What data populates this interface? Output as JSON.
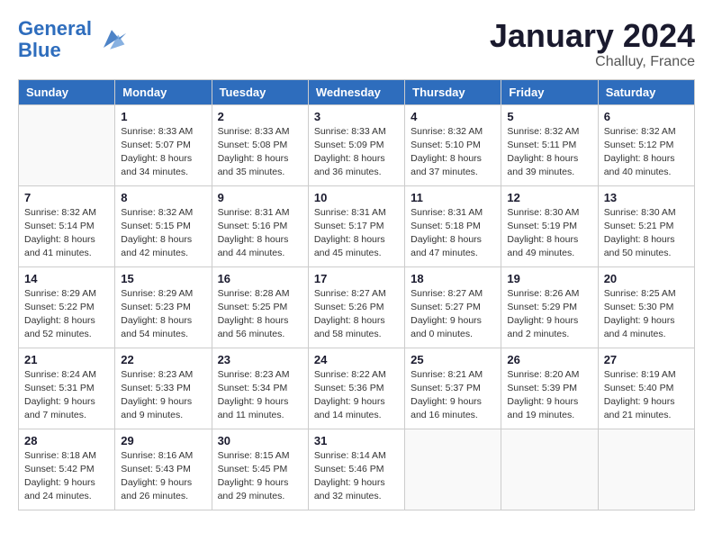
{
  "header": {
    "logo_line1": "General",
    "logo_line2": "Blue",
    "month_title": "January 2024",
    "location": "Challuy, France"
  },
  "days_of_week": [
    "Sunday",
    "Monday",
    "Tuesday",
    "Wednesday",
    "Thursday",
    "Friday",
    "Saturday"
  ],
  "weeks": [
    [
      {
        "day": "",
        "info": ""
      },
      {
        "day": "1",
        "info": "Sunrise: 8:33 AM\nSunset: 5:07 PM\nDaylight: 8 hours\nand 34 minutes."
      },
      {
        "day": "2",
        "info": "Sunrise: 8:33 AM\nSunset: 5:08 PM\nDaylight: 8 hours\nand 35 minutes."
      },
      {
        "day": "3",
        "info": "Sunrise: 8:33 AM\nSunset: 5:09 PM\nDaylight: 8 hours\nand 36 minutes."
      },
      {
        "day": "4",
        "info": "Sunrise: 8:32 AM\nSunset: 5:10 PM\nDaylight: 8 hours\nand 37 minutes."
      },
      {
        "day": "5",
        "info": "Sunrise: 8:32 AM\nSunset: 5:11 PM\nDaylight: 8 hours\nand 39 minutes."
      },
      {
        "day": "6",
        "info": "Sunrise: 8:32 AM\nSunset: 5:12 PM\nDaylight: 8 hours\nand 40 minutes."
      }
    ],
    [
      {
        "day": "7",
        "info": "Sunrise: 8:32 AM\nSunset: 5:14 PM\nDaylight: 8 hours\nand 41 minutes."
      },
      {
        "day": "8",
        "info": "Sunrise: 8:32 AM\nSunset: 5:15 PM\nDaylight: 8 hours\nand 42 minutes."
      },
      {
        "day": "9",
        "info": "Sunrise: 8:31 AM\nSunset: 5:16 PM\nDaylight: 8 hours\nand 44 minutes."
      },
      {
        "day": "10",
        "info": "Sunrise: 8:31 AM\nSunset: 5:17 PM\nDaylight: 8 hours\nand 45 minutes."
      },
      {
        "day": "11",
        "info": "Sunrise: 8:31 AM\nSunset: 5:18 PM\nDaylight: 8 hours\nand 47 minutes."
      },
      {
        "day": "12",
        "info": "Sunrise: 8:30 AM\nSunset: 5:19 PM\nDaylight: 8 hours\nand 49 minutes."
      },
      {
        "day": "13",
        "info": "Sunrise: 8:30 AM\nSunset: 5:21 PM\nDaylight: 8 hours\nand 50 minutes."
      }
    ],
    [
      {
        "day": "14",
        "info": "Sunrise: 8:29 AM\nSunset: 5:22 PM\nDaylight: 8 hours\nand 52 minutes."
      },
      {
        "day": "15",
        "info": "Sunrise: 8:29 AM\nSunset: 5:23 PM\nDaylight: 8 hours\nand 54 minutes."
      },
      {
        "day": "16",
        "info": "Sunrise: 8:28 AM\nSunset: 5:25 PM\nDaylight: 8 hours\nand 56 minutes."
      },
      {
        "day": "17",
        "info": "Sunrise: 8:27 AM\nSunset: 5:26 PM\nDaylight: 8 hours\nand 58 minutes."
      },
      {
        "day": "18",
        "info": "Sunrise: 8:27 AM\nSunset: 5:27 PM\nDaylight: 9 hours\nand 0 minutes."
      },
      {
        "day": "19",
        "info": "Sunrise: 8:26 AM\nSunset: 5:29 PM\nDaylight: 9 hours\nand 2 minutes."
      },
      {
        "day": "20",
        "info": "Sunrise: 8:25 AM\nSunset: 5:30 PM\nDaylight: 9 hours\nand 4 minutes."
      }
    ],
    [
      {
        "day": "21",
        "info": "Sunrise: 8:24 AM\nSunset: 5:31 PM\nDaylight: 9 hours\nand 7 minutes."
      },
      {
        "day": "22",
        "info": "Sunrise: 8:23 AM\nSunset: 5:33 PM\nDaylight: 9 hours\nand 9 minutes."
      },
      {
        "day": "23",
        "info": "Sunrise: 8:23 AM\nSunset: 5:34 PM\nDaylight: 9 hours\nand 11 minutes."
      },
      {
        "day": "24",
        "info": "Sunrise: 8:22 AM\nSunset: 5:36 PM\nDaylight: 9 hours\nand 14 minutes."
      },
      {
        "day": "25",
        "info": "Sunrise: 8:21 AM\nSunset: 5:37 PM\nDaylight: 9 hours\nand 16 minutes."
      },
      {
        "day": "26",
        "info": "Sunrise: 8:20 AM\nSunset: 5:39 PM\nDaylight: 9 hours\nand 19 minutes."
      },
      {
        "day": "27",
        "info": "Sunrise: 8:19 AM\nSunset: 5:40 PM\nDaylight: 9 hours\nand 21 minutes."
      }
    ],
    [
      {
        "day": "28",
        "info": "Sunrise: 8:18 AM\nSunset: 5:42 PM\nDaylight: 9 hours\nand 24 minutes."
      },
      {
        "day": "29",
        "info": "Sunrise: 8:16 AM\nSunset: 5:43 PM\nDaylight: 9 hours\nand 26 minutes."
      },
      {
        "day": "30",
        "info": "Sunrise: 8:15 AM\nSunset: 5:45 PM\nDaylight: 9 hours\nand 29 minutes."
      },
      {
        "day": "31",
        "info": "Sunrise: 8:14 AM\nSunset: 5:46 PM\nDaylight: 9 hours\nand 32 minutes."
      },
      {
        "day": "",
        "info": ""
      },
      {
        "day": "",
        "info": ""
      },
      {
        "day": "",
        "info": ""
      }
    ]
  ]
}
